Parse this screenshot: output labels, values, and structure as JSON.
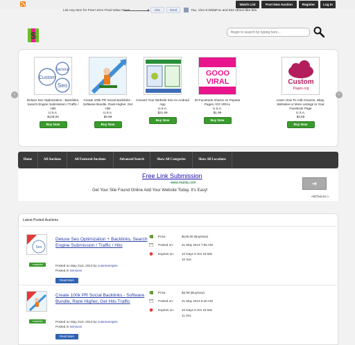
{
  "topbar": {
    "buttons": [
      "Watch List",
      "Post New Auction",
      "Register",
      "Log In"
    ]
  },
  "header": {
    "promo": "List Any Item for Free! Zero Final Value Fees!",
    "fb_like": "Like",
    "fb_send": "Send",
    "fb_text": "You, Vivo 8 WidaFox and 922 others like this.",
    "search_placeholder": "Begin to search by typing here..."
  },
  "colors": {
    "buy_now": "#3a9b2d",
    "nav_bg": "#3a3a3a",
    "link": "#2a3fa6",
    "read_more": "#2f63b3"
  },
  "carousel": {
    "prev_arrow": "‹",
    "next_arrow": "›",
    "items": [
      {
        "title": "Deluxe Seo Optimization - Backlinks, Search Engine Submission / Traffic / Hits",
        "country": "U.S.A.",
        "price": "$129.00",
        "button": "Buy Now",
        "thumb": "Custom Seo Service"
      },
      {
        "title": "Create 100k PR Social Backlinks - Software Bundle, Rank Higher, Get Hits",
        "country": "U.S.A.",
        "price": "$3.99",
        "button": "Buy Now",
        "thumb": "backlinks"
      },
      {
        "title": "Convert Your Website Into An Android App",
        "country": "U.S.A.",
        "price": "$21.99",
        "button": "Buy Now",
        "thumb": "Convert Your Site to App"
      },
      {
        "title": "20 Facebook Shares on Popular Pages, GO VIRAL",
        "country": "U.S.A.",
        "price": "$1.99",
        "button": "Buy Now",
        "thumb": "GOOO VIRAL"
      },
      {
        "title": "Learn How To Add Amazon, eBay, Websites or More Listings to Your Facebook Page",
        "country": "U.S.A.",
        "price": "$3.59",
        "button": "Buy Now",
        "thumb": "Custom Pages.org"
      }
    ]
  },
  "nav": {
    "items": [
      "Home",
      "All Auctions",
      "All Featured Auctions",
      "Advanced Search",
      "Show All Categories",
      "Show All Locations"
    ]
  },
  "ad": {
    "title": "Free Link Submission",
    "url": "www.manta.com",
    "desc": "Get Your Site Found Online Add Your Website Today. It's Easy!",
    "button": "➔",
    "choices": "AdChoices ▷"
  },
  "latest": {
    "title": "Latest Posted Auctions",
    "items": [
      {
        "title": "Deluxe Seo Optimization + Backlinks, Search Engine Submission / Traffic / Hits",
        "watch": "+watchlist",
        "posted": "Posted on May 21st, 2013 by",
        "user": "customempire",
        "category_prefix": "Posted in",
        "category": "Services",
        "read_more": "Read More",
        "price_label": "Price:",
        "price": "$129.00 (BuyNow)",
        "posted_label": "Posted on:",
        "posted_on": "21 May 2013 7:55 AM",
        "expires_label": "Expires on:",
        "expires": "10 Days 5 Hrs 19 Min",
        "expires2": "10 Sec"
      },
      {
        "title": "Create 100k PR Social Backlinks - Software Bundle, Rank Higher, Get Hits Traffic",
        "watch": "+watchlist",
        "posted": "Posted on May 21st, 2013 by",
        "user": "customempire",
        "category_prefix": "Posted in",
        "category": "Services",
        "read_more": "Read More",
        "price_label": "Price:",
        "price": "$3.99 (BuyNow)",
        "posted_label": "Posted on:",
        "posted_on": "21 May 2013 6:40 AM",
        "expires_label": "Expires on:",
        "expires": "10 Days 5 Hrs 19 Min",
        "expires2": "11 Sec"
      }
    ]
  }
}
